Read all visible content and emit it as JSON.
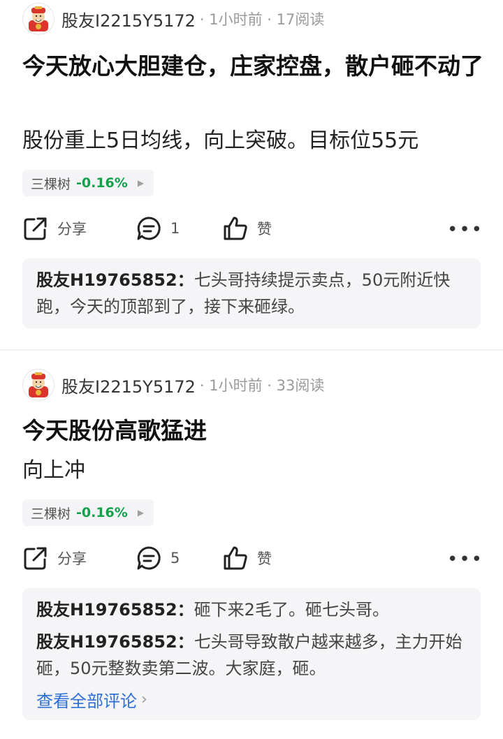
{
  "posts": [
    {
      "author": "股友I2215Y5172",
      "meta": "· 1小时前 · 17阅读",
      "title": "今天放心大胆建仓，庄家控盘，散户砸不动了",
      "body": "股份重上5日均线，向上突破。目标位55元",
      "stock": {
        "name": "三棵树",
        "change": "-0.16%"
      },
      "actions": {
        "share": "分享",
        "comment_count": "1",
        "like": "赞"
      },
      "comments": [
        {
          "user": "股友H19765852：",
          "text": "七头哥持续提示卖点，50元附近快跑，今天的顶部到了，接下来砸绿。"
        }
      ]
    },
    {
      "author": "股友I2215Y5172",
      "meta": "· 1小时前 · 33阅读",
      "title": "今天股份高歌猛进",
      "body": "向上冲",
      "stock": {
        "name": "三棵树",
        "change": "-0.16%"
      },
      "actions": {
        "share": "分享",
        "comment_count": "5",
        "like": "赞"
      },
      "comments": [
        {
          "user": "股友H19765852：",
          "text": "砸下来2毛了。砸七头哥。"
        },
        {
          "user": "股友H19765852：",
          "text": "七头哥导致散户越来越多，主力开始砸，50元整数卖第二波。大家庭，砸。"
        }
      ],
      "view_all": "查看全部评论"
    }
  ],
  "icons": {
    "avatar": "fortune-god-avatar-icon",
    "share": "share-icon",
    "comment": "comment-icon",
    "like": "thumbs-up-icon",
    "more": "more-dots-icon"
  },
  "colors": {
    "negative_change": "#12a04a",
    "link": "#2c6fd6"
  }
}
